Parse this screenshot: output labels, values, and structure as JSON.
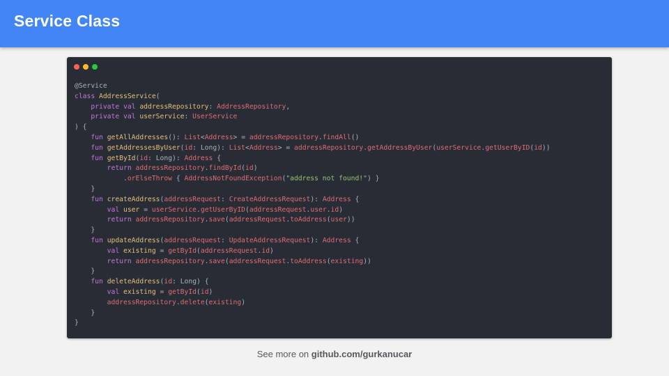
{
  "header": {
    "title": "Service Class",
    "bg": "#4285f4"
  },
  "code_window": {
    "bg": "#282c34",
    "dots": [
      {
        "name": "close-dot",
        "color": "#ff5f56"
      },
      {
        "name": "minimize-dot",
        "color": "#ffbd2e"
      },
      {
        "name": "maximize-dot",
        "color": "#27c93f"
      }
    ],
    "lines": [
      [
        [
          "ann",
          "@Service"
        ]
      ],
      [
        [
          "kw",
          "class "
        ],
        [
          "fn",
          "AddressService"
        ],
        [
          "plain",
          "("
        ]
      ],
      [
        [
          "plain",
          "    "
        ],
        [
          "kw",
          "private val "
        ],
        [
          "fn",
          "addressRepository"
        ],
        [
          "plain",
          ": "
        ],
        [
          "type",
          "AddressRepository"
        ],
        [
          "plain",
          ","
        ]
      ],
      [
        [
          "plain",
          "    "
        ],
        [
          "kw",
          "private val "
        ],
        [
          "fn",
          "userService"
        ],
        [
          "plain",
          ": "
        ],
        [
          "type",
          "UserService"
        ]
      ],
      [
        [
          "plain",
          ") {"
        ]
      ],
      [
        [
          "plain",
          "    "
        ],
        [
          "kw",
          "fun "
        ],
        [
          "fn",
          "getAllAddresses"
        ],
        [
          "plain",
          "(): "
        ],
        [
          "type",
          "List"
        ],
        [
          "plain",
          "<"
        ],
        [
          "type",
          "Address"
        ],
        [
          "plain",
          "> = "
        ],
        [
          "prop",
          "addressRepository"
        ],
        [
          "plain",
          "."
        ],
        [
          "prop",
          "findAll"
        ],
        [
          "plain",
          "()"
        ]
      ],
      [
        [
          "plain",
          "    "
        ],
        [
          "kw",
          "fun "
        ],
        [
          "fn",
          "getAddressesByUser"
        ],
        [
          "plain",
          "("
        ],
        [
          "prop",
          "id"
        ],
        [
          "plain",
          ": Long): "
        ],
        [
          "type",
          "List"
        ],
        [
          "plain",
          "<"
        ],
        [
          "type",
          "Address"
        ],
        [
          "plain",
          "> = "
        ],
        [
          "prop",
          "addressRepository"
        ],
        [
          "plain",
          "."
        ],
        [
          "prop",
          "getAddressByUser"
        ],
        [
          "plain",
          "("
        ],
        [
          "prop",
          "userService"
        ],
        [
          "plain",
          "."
        ],
        [
          "prop",
          "getUserByID"
        ],
        [
          "plain",
          "("
        ],
        [
          "prop",
          "id"
        ],
        [
          "plain",
          "))"
        ]
      ],
      [
        [
          "plain",
          "    "
        ],
        [
          "kw",
          "fun "
        ],
        [
          "fn",
          "getById"
        ],
        [
          "plain",
          "("
        ],
        [
          "prop",
          "id"
        ],
        [
          "plain",
          ": Long): "
        ],
        [
          "type",
          "Address"
        ],
        [
          "plain",
          " {"
        ]
      ],
      [
        [
          "plain",
          "        "
        ],
        [
          "kw",
          "return "
        ],
        [
          "prop",
          "addressRepository"
        ],
        [
          "plain",
          "."
        ],
        [
          "prop",
          "findById"
        ],
        [
          "plain",
          "("
        ],
        [
          "prop",
          "id"
        ],
        [
          "plain",
          ")"
        ]
      ],
      [
        [
          "plain",
          "            ."
        ],
        [
          "prop",
          "orElseThrow"
        ],
        [
          "plain",
          " { "
        ],
        [
          "type",
          "AddressNotFoundException"
        ],
        [
          "plain",
          "("
        ],
        [
          "str",
          "\"address not found!\""
        ],
        [
          "plain",
          ") }"
        ]
      ],
      [
        [
          "plain",
          "    }"
        ]
      ],
      [
        [
          "plain",
          "    "
        ],
        [
          "kw",
          "fun "
        ],
        [
          "fn",
          "createAddress"
        ],
        [
          "plain",
          "("
        ],
        [
          "prop",
          "addressRequest"
        ],
        [
          "plain",
          ": "
        ],
        [
          "type",
          "CreateAddressRequest"
        ],
        [
          "plain",
          "): "
        ],
        [
          "type",
          "Address"
        ],
        [
          "plain",
          " {"
        ]
      ],
      [
        [
          "plain",
          "        "
        ],
        [
          "kw",
          "val "
        ],
        [
          "fn",
          "user"
        ],
        [
          "plain",
          " = "
        ],
        [
          "prop",
          "userService"
        ],
        [
          "plain",
          "."
        ],
        [
          "prop",
          "getUserByID"
        ],
        [
          "plain",
          "("
        ],
        [
          "prop",
          "addressRequest"
        ],
        [
          "plain",
          "."
        ],
        [
          "prop",
          "user"
        ],
        [
          "plain",
          "."
        ],
        [
          "prop",
          "id"
        ],
        [
          "plain",
          ")"
        ]
      ],
      [
        [
          "plain",
          "        "
        ],
        [
          "kw",
          "return "
        ],
        [
          "prop",
          "addressRepository"
        ],
        [
          "plain",
          "."
        ],
        [
          "prop",
          "save"
        ],
        [
          "plain",
          "("
        ],
        [
          "prop",
          "addressRequest"
        ],
        [
          "plain",
          "."
        ],
        [
          "prop",
          "toAddress"
        ],
        [
          "plain",
          "("
        ],
        [
          "prop",
          "user"
        ],
        [
          "plain",
          "))"
        ]
      ],
      [
        [
          "plain",
          "    }"
        ]
      ],
      [
        [
          "plain",
          "    "
        ],
        [
          "kw",
          "fun "
        ],
        [
          "fn",
          "updateAddress"
        ],
        [
          "plain",
          "("
        ],
        [
          "prop",
          "addressRequest"
        ],
        [
          "plain",
          ": "
        ],
        [
          "type",
          "UpdateAddressRequest"
        ],
        [
          "plain",
          "): "
        ],
        [
          "type",
          "Address"
        ],
        [
          "plain",
          " {"
        ]
      ],
      [
        [
          "plain",
          "        "
        ],
        [
          "kw",
          "val "
        ],
        [
          "fn",
          "existing"
        ],
        [
          "plain",
          " = "
        ],
        [
          "prop",
          "getById"
        ],
        [
          "plain",
          "("
        ],
        [
          "prop",
          "addressRequest"
        ],
        [
          "plain",
          "."
        ],
        [
          "prop",
          "id"
        ],
        [
          "plain",
          ")"
        ]
      ],
      [
        [
          "plain",
          "        "
        ],
        [
          "kw",
          "return "
        ],
        [
          "prop",
          "addressRepository"
        ],
        [
          "plain",
          "."
        ],
        [
          "prop",
          "save"
        ],
        [
          "plain",
          "("
        ],
        [
          "prop",
          "addressRequest"
        ],
        [
          "plain",
          "."
        ],
        [
          "prop",
          "toAddress"
        ],
        [
          "plain",
          "("
        ],
        [
          "prop",
          "existing"
        ],
        [
          "plain",
          "))"
        ]
      ],
      [
        [
          "plain",
          "    }"
        ]
      ],
      [
        [
          "plain",
          "    "
        ],
        [
          "kw",
          "fun "
        ],
        [
          "fn",
          "deleteAddress"
        ],
        [
          "plain",
          "("
        ],
        [
          "prop",
          "id"
        ],
        [
          "plain",
          ": Long) {"
        ]
      ],
      [
        [
          "plain",
          "        "
        ],
        [
          "kw",
          "val "
        ],
        [
          "fn",
          "existing"
        ],
        [
          "plain",
          " = "
        ],
        [
          "prop",
          "getById"
        ],
        [
          "plain",
          "("
        ],
        [
          "prop",
          "id"
        ],
        [
          "plain",
          ")"
        ]
      ],
      [
        [
          "plain",
          "        "
        ],
        [
          "prop",
          "addressRepository"
        ],
        [
          "plain",
          "."
        ],
        [
          "prop",
          "delete"
        ],
        [
          "plain",
          "("
        ],
        [
          "prop",
          "existing"
        ],
        [
          "plain",
          ")"
        ]
      ],
      [
        [
          "plain",
          "    }"
        ]
      ],
      [
        [
          "plain",
          "}"
        ]
      ]
    ]
  },
  "footer": {
    "prefix": "See more  on ",
    "link": "github.com/gurkanucar"
  }
}
